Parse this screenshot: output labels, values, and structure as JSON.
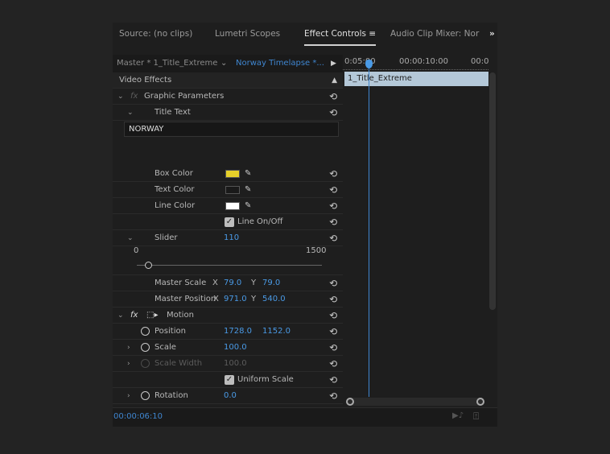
{
  "tabs": [
    {
      "label": "Source: (no clips)"
    },
    {
      "label": "Lumetri Scopes"
    },
    {
      "label": "Effect Controls"
    },
    {
      "label": "Audio Clip Mixer: Nor"
    }
  ],
  "overflow_icon": "double-chevron-right-icon",
  "menu_icon": "hamburger-icon",
  "header": {
    "master": "Master * 1_Title_Extreme",
    "sequence": "Norway Timelapse *..."
  },
  "timeline": {
    "tc1": "0:05:00",
    "tc2": "00:00:10:00",
    "tc3": "00:0",
    "clip": "1_Title_Extreme"
  },
  "section": "Video Effects",
  "graphic": {
    "name": "Graphic Parameters",
    "title_text": "Title Text",
    "text_value": "NORWAY",
    "box_color": "Box Color",
    "box_color_value": "#e6d02a",
    "text_color": "Text Color",
    "text_color_value": "#1a1a1a",
    "line_color": "Line Color",
    "line_color_value": "#ffffff",
    "line_onoff": "Line On/Off",
    "slider": "Slider",
    "slider_value": "110",
    "slider_min": "0",
    "slider_max": "1500",
    "master_scale": "Master Scale",
    "ms_x_label": "X",
    "ms_x": "79.0",
    "ms_y_label": "Y",
    "ms_y": "79.0",
    "master_position": "Master Position",
    "mp_x_label": "X",
    "mp_x": "971.0",
    "mp_y_label": "Y",
    "mp_y": "540.0"
  },
  "motion": {
    "name": "Motion",
    "position": "Position",
    "pos_x": "1728.0",
    "pos_y": "1152.0",
    "scale": "Scale",
    "scale_value": "100.0",
    "scale_width": "Scale Width",
    "scale_width_value": "100.0",
    "uniform_scale": "Uniform Scale",
    "rotation": "Rotation",
    "rotation_value": "0.0"
  },
  "footer": {
    "timecode": "00:00:06:10"
  },
  "colors": {
    "accent": "#4a9ae6",
    "clip": "#b4c8d8"
  }
}
